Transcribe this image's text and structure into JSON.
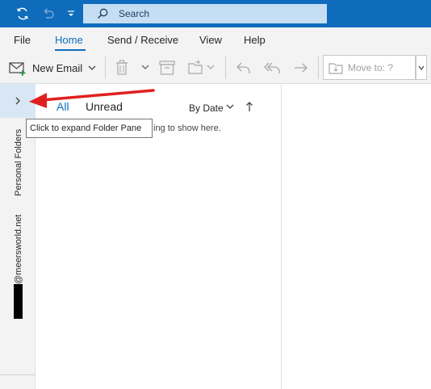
{
  "titlebar": {
    "search_label": "Search",
    "icons": [
      "sync-icon",
      "undo-icon",
      "customize-qat-icon",
      "search-icon"
    ]
  },
  "menu": {
    "tabs": [
      {
        "label": "File"
      },
      {
        "label": "Home",
        "active": true
      },
      {
        "label": "Send / Receive"
      },
      {
        "label": "View"
      },
      {
        "label": "Help"
      }
    ]
  },
  "ribbon": {
    "new_email_label": "New Email",
    "move_to_label": "Move to: ?"
  },
  "folder_strip": {
    "personal_folders_label": "Personal Folders",
    "account_label": "@meersworld.net"
  },
  "list": {
    "filter_all": "All",
    "filter_unread": "Unread",
    "sort_label": "By Date",
    "empty_message": "ing to show here."
  },
  "tooltip": {
    "text": "Click to expand Folder Pane"
  },
  "colors": {
    "accent": "#0f6cbd",
    "annotation_arrow": "#e02020"
  }
}
